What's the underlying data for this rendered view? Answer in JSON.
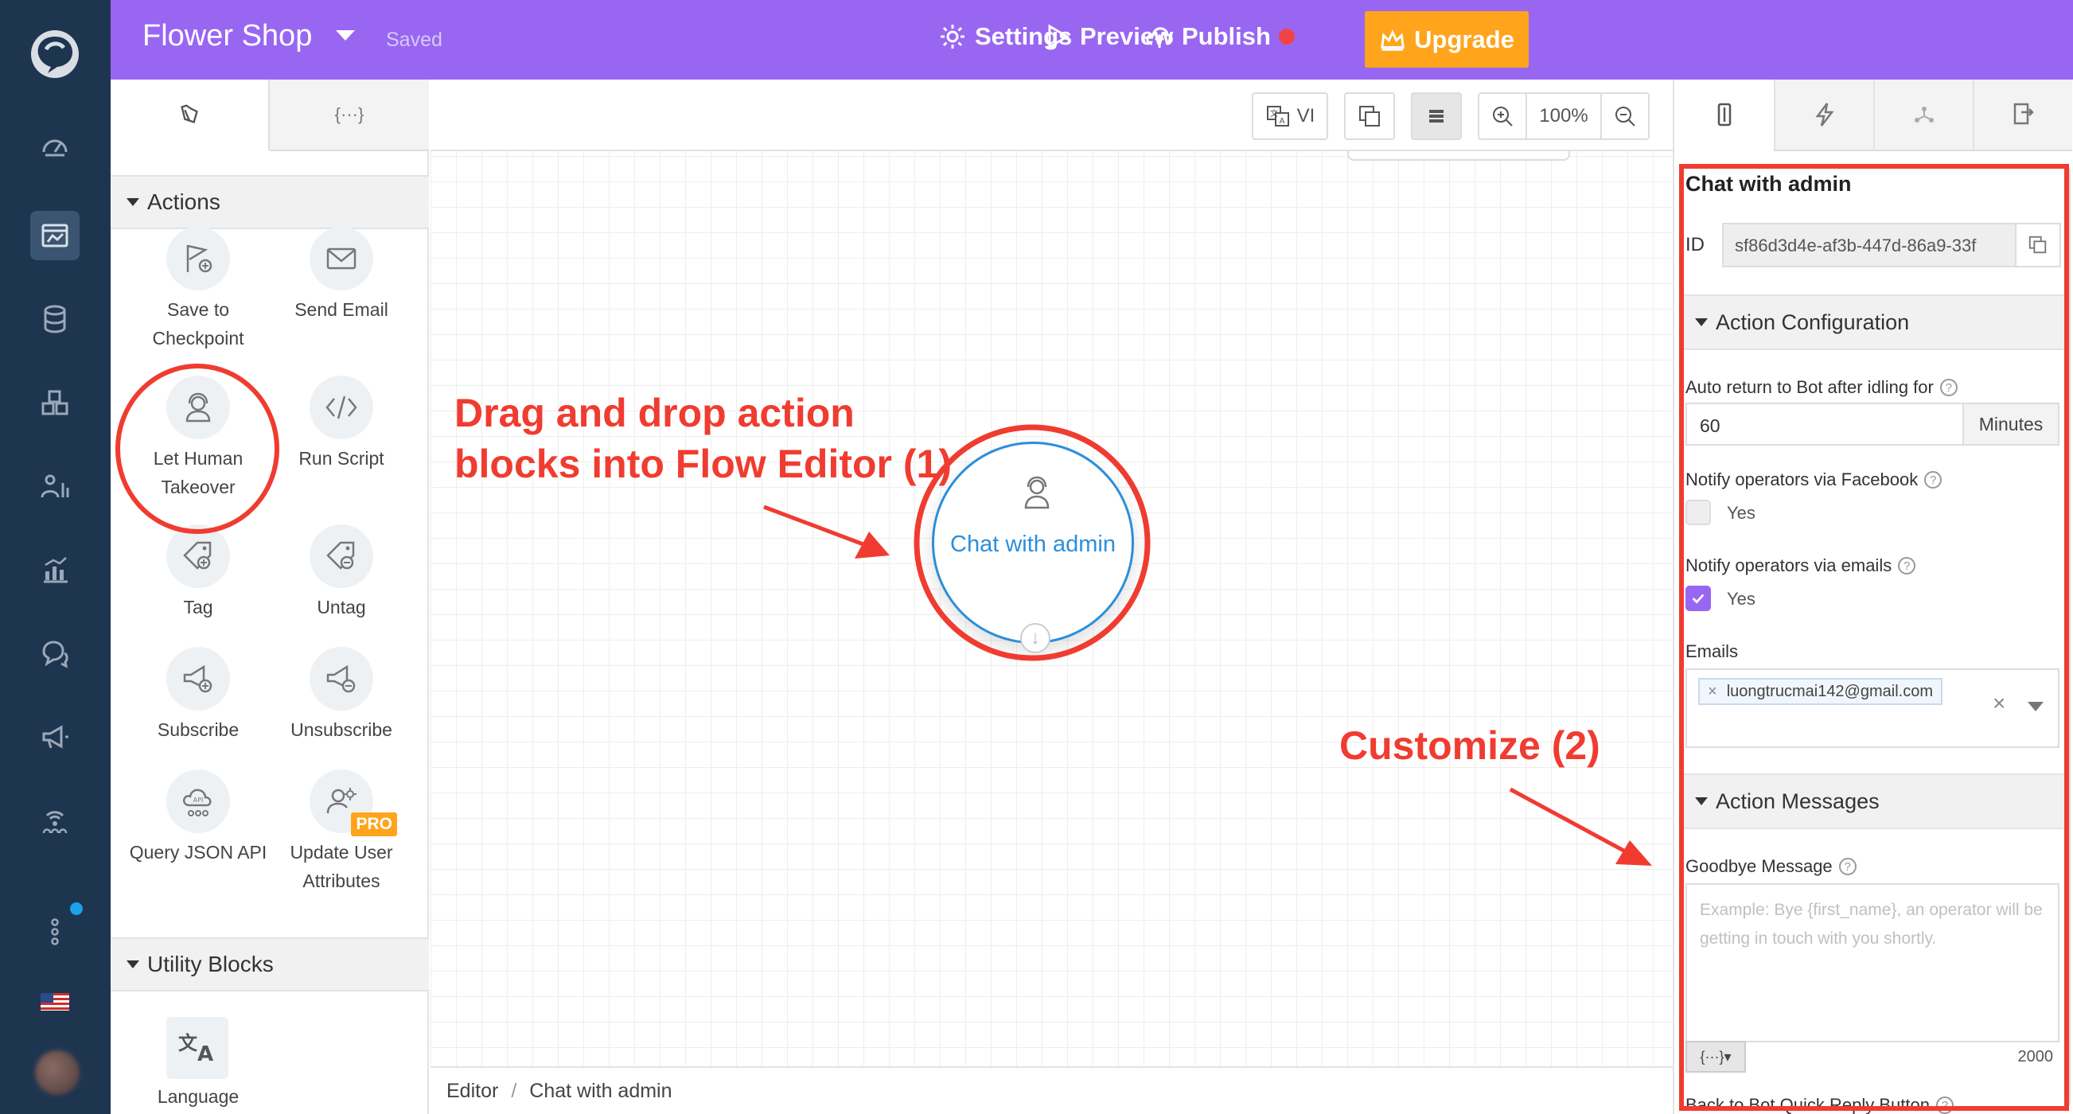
{
  "app": {
    "title": "Flower Shop",
    "status": "Saved",
    "brand_color": "#9966f2",
    "accent_color": "#ffa41b"
  },
  "topbar": {
    "upgrade_label": "Upgrade",
    "settings_label": "Settings",
    "preview_label": "Preview",
    "publish_label": "Publish"
  },
  "left_panel": {
    "tabs": [
      {
        "icon": "blocks-icon"
      },
      {
        "icon": "variables-icon",
        "label": "{···}"
      }
    ],
    "actions_section": "Actions",
    "actions": [
      {
        "label": "Save to Checkpoint",
        "icon": "flag-plus-icon"
      },
      {
        "label": "Send Email",
        "icon": "envelope-icon"
      },
      {
        "label": "Let Human Takeover",
        "icon": "headset-user-icon"
      },
      {
        "label": "Run Script",
        "icon": "code-icon"
      },
      {
        "label": "Tag",
        "icon": "tag-plus-icon"
      },
      {
        "label": "Untag",
        "icon": "tag-minus-icon"
      },
      {
        "label": "Subscribe",
        "icon": "megaphone-plus-icon"
      },
      {
        "label": "Unsubscribe",
        "icon": "megaphone-minus-icon"
      },
      {
        "label": "Query JSON API",
        "icon": "cloud-api-icon"
      },
      {
        "label": "Update User Attributes",
        "icon": "user-gear-icon",
        "badge": "PRO"
      }
    ],
    "utility_section": "Utility Blocks",
    "utility": [
      {
        "label": "Language",
        "icon": "translate-icon"
      }
    ]
  },
  "canvas": {
    "lang_label": "VI",
    "zoom": "100%",
    "node_label": "Chat with admin",
    "breadcrumb_root": "Editor",
    "breadcrumb_sep": "/",
    "breadcrumb_current": "Chat with admin"
  },
  "annotations": {
    "step1_line1": "Drag and drop action",
    "step1_line2": "blocks into Flow Editor (1)",
    "step2": "Customize (2)",
    "color": "#f03c30"
  },
  "right_panel": {
    "title": "Chat with admin",
    "id_label": "ID",
    "id_value": "sf86d3d4e-af3b-447d-86a9-33f",
    "action_config_section": "Action Configuration",
    "auto_return_label": "Auto return to Bot after idling for",
    "auto_return_value": "60",
    "auto_return_unit": "Minutes",
    "notify_facebook_label": "Notify operators via Facebook",
    "notify_facebook_option": "Yes",
    "notify_facebook_checked": false,
    "notify_email_label": "Notify operators via emails",
    "notify_email_option": "Yes",
    "notify_email_checked": true,
    "emails_label": "Emails",
    "email_tag": "luongtrucmai142@gmail.com",
    "email_tag_remove": "×",
    "emails_clear": "×",
    "action_messages_section": "Action Messages",
    "goodbye_label": "Goodbye Message",
    "goodbye_placeholder": "Example: Bye {first_name}, an operator will be getting in touch with you shortly.",
    "goodbye_var_button": "{···}▾",
    "goodbye_max": "2000",
    "back_to_bot_label": "Back to Bot Quick Reply Button"
  }
}
